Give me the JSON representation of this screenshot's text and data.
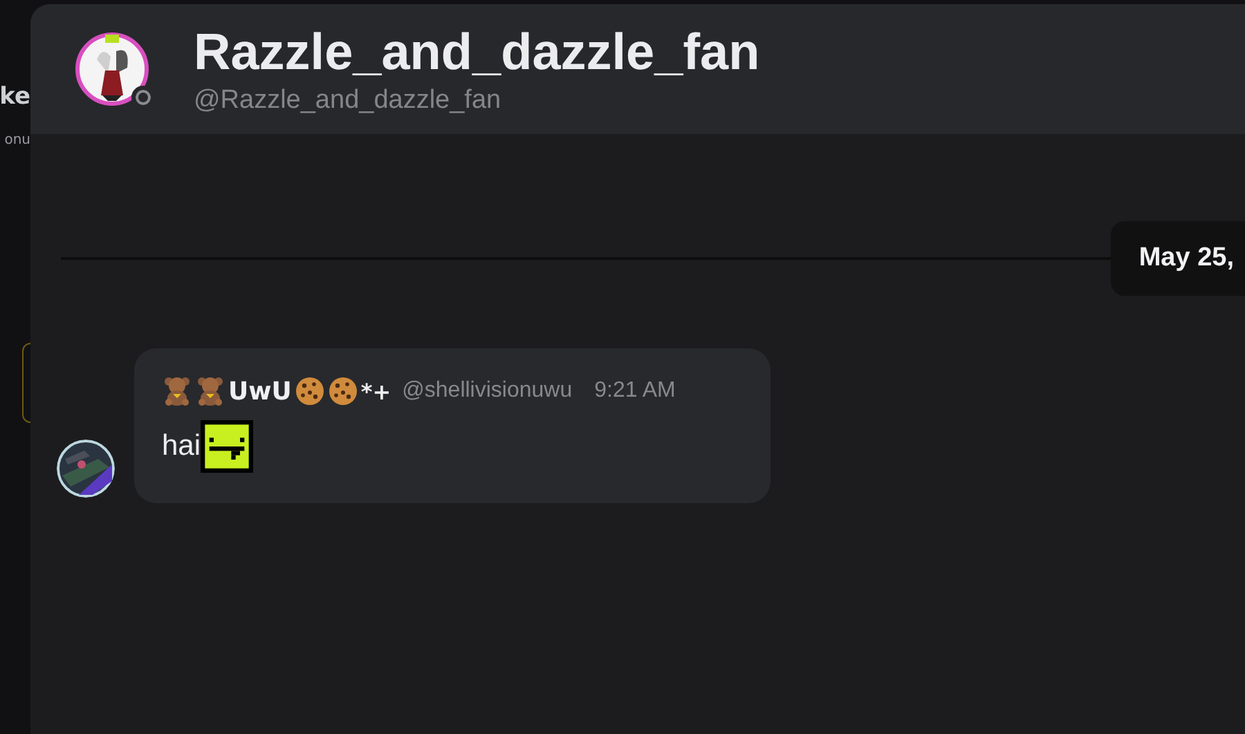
{
  "background_page": {
    "title_fragment": "ke",
    "subtitle_fragment": "onu"
  },
  "profile": {
    "display_name": "Razzle_and_dazzle_fan",
    "handle": "@Razzle_and_dazzle_fan",
    "online": false
  },
  "date_divider": "May 25,",
  "messages": [
    {
      "display_name": "UwU",
      "name_suffix": "*+",
      "handle": "@shellivisionuwu",
      "time": "9:21 AM",
      "text": "hai"
    }
  ]
}
